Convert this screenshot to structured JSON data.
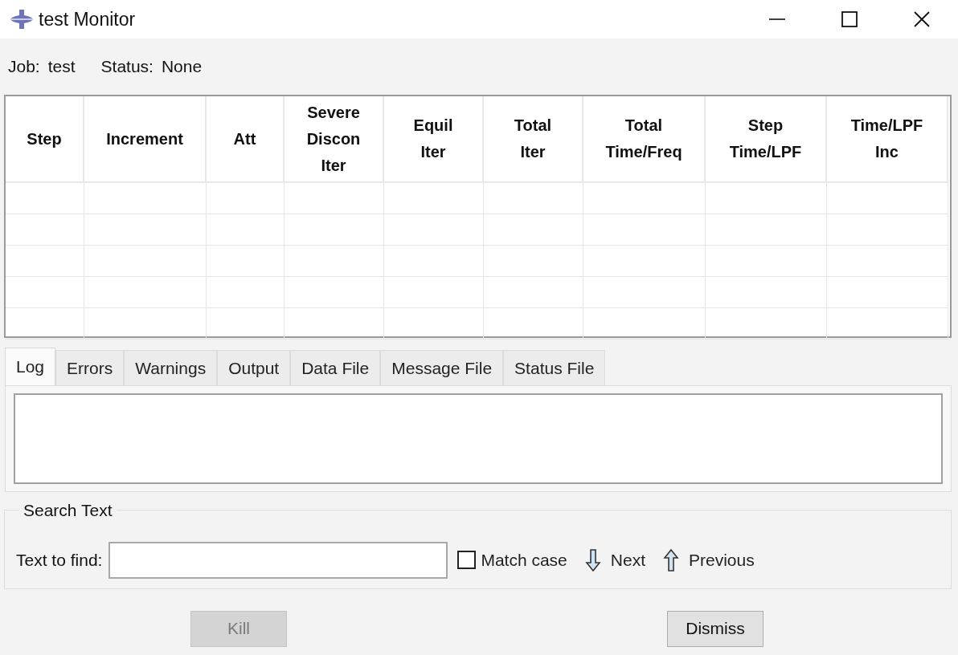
{
  "window": {
    "title": "test Monitor"
  },
  "job": {
    "label": "Job:",
    "value": "test"
  },
  "status": {
    "label": "Status:",
    "value": "None"
  },
  "table": {
    "columns": [
      "Step",
      "Increment",
      "Att",
      "Severe\nDiscon\nIter",
      "Equil\nIter",
      "Total\nIter",
      "Total\nTime/Freq",
      "Step\nTime/LPF",
      "Time/LPF\nInc"
    ]
  },
  "tabs": [
    {
      "label": "Log",
      "selected": true
    },
    {
      "label": "Errors",
      "selected": false
    },
    {
      "label": "Warnings",
      "selected": false
    },
    {
      "label": "Output",
      "selected": false
    },
    {
      "label": "Data File",
      "selected": false
    },
    {
      "label": "Message File",
      "selected": false
    },
    {
      "label": "Status File",
      "selected": false
    }
  ],
  "search": {
    "title": "Search Text",
    "label": "Text to find:",
    "match_case": {
      "label": "Match case",
      "checked": false
    },
    "next": "Next",
    "previous": "Previous"
  },
  "buttons": [
    {
      "label": "Kill",
      "disabled": true
    },
    {
      "label": "Dismiss",
      "disabled": false
    }
  ]
}
